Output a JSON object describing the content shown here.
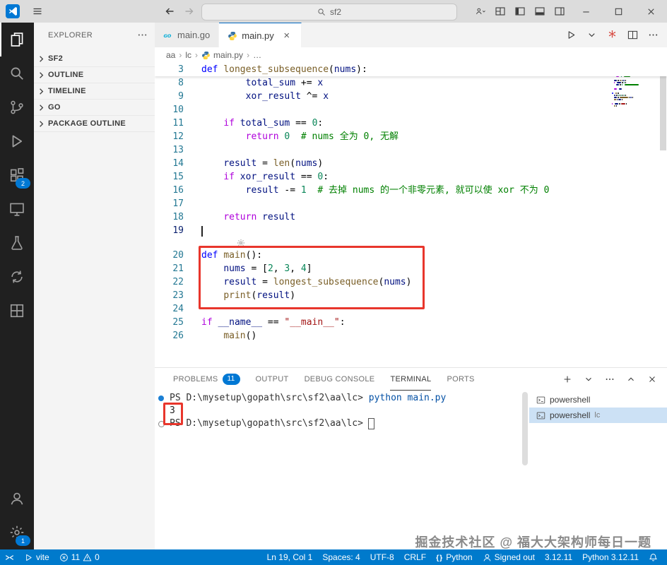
{
  "titlebar": {
    "search": "sf2",
    "right_icons": [
      "profile",
      "layout-grid",
      "sidebar-left",
      "panel-bottom",
      "sidebar-right"
    ],
    "window_controls": [
      "minimize",
      "maximize",
      "close"
    ]
  },
  "activity_bar": {
    "items": [
      {
        "name": "explorer",
        "active": true
      },
      {
        "name": "search"
      },
      {
        "name": "source-control"
      },
      {
        "name": "run-debug"
      },
      {
        "name": "extensions",
        "badge": "2"
      },
      {
        "name": "remote-explorer"
      },
      {
        "name": "testing"
      },
      {
        "name": "sync"
      },
      {
        "name": "grid"
      }
    ],
    "bottom": [
      {
        "name": "account"
      },
      {
        "name": "settings",
        "badge": "1"
      }
    ]
  },
  "sidebar": {
    "title": "EXPLORER",
    "sections": [
      {
        "label": "SF2"
      },
      {
        "label": "OUTLINE"
      },
      {
        "label": "TIMELINE"
      },
      {
        "label": "GO"
      },
      {
        "label": "PACKAGE OUTLINE"
      }
    ]
  },
  "editor_tabs": [
    {
      "label": "main.go",
      "icon": "go",
      "active": false
    },
    {
      "label": "main.py",
      "icon": "python",
      "active": true,
      "close": "×"
    }
  ],
  "editor_actions": [
    "run",
    "chevron-down",
    "extension",
    "split-editor",
    "more"
  ],
  "breadcrumb": [
    {
      "label": "aa"
    },
    {
      "label": "lc"
    },
    {
      "label": "main.py",
      "icon": "python"
    },
    {
      "label": "…"
    }
  ],
  "editor": {
    "cursor_line": "19",
    "lines": [
      {
        "num": "3",
        "sticky": true,
        "tokens": [
          {
            "t": "def",
            "c": "kw"
          },
          {
            "t": " "
          },
          {
            "t": "longest_subsequence",
            "c": "fn"
          },
          {
            "t": "("
          },
          {
            "t": "nums",
            "c": "var"
          },
          {
            "t": "):"
          }
        ]
      },
      {
        "num": "8",
        "tokens": [
          {
            "t": "        "
          },
          {
            "t": "total_sum",
            "c": "var"
          },
          {
            "t": " += "
          },
          {
            "t": "x",
            "c": "var"
          }
        ]
      },
      {
        "num": "9",
        "tokens": [
          {
            "t": "        "
          },
          {
            "t": "xor_result",
            "c": "var"
          },
          {
            "t": " ^= "
          },
          {
            "t": "x",
            "c": "var"
          }
        ]
      },
      {
        "num": "10",
        "tokens": []
      },
      {
        "num": "11",
        "tokens": [
          {
            "t": "    "
          },
          {
            "t": "if",
            "c": "ctrl"
          },
          {
            "t": " "
          },
          {
            "t": "total_sum",
            "c": "var"
          },
          {
            "t": " == "
          },
          {
            "t": "0",
            "c": "num"
          },
          {
            "t": ":"
          }
        ]
      },
      {
        "num": "12",
        "tokens": [
          {
            "t": "        "
          },
          {
            "t": "return",
            "c": "ctrl"
          },
          {
            "t": " "
          },
          {
            "t": "0",
            "c": "num"
          },
          {
            "t": "  "
          },
          {
            "t": "# nums 全为 0, 无解",
            "c": "com"
          }
        ]
      },
      {
        "num": "13",
        "tokens": []
      },
      {
        "num": "14",
        "tokens": [
          {
            "t": "    "
          },
          {
            "t": "result",
            "c": "var"
          },
          {
            "t": " = "
          },
          {
            "t": "len",
            "c": "fn"
          },
          {
            "t": "("
          },
          {
            "t": "nums",
            "c": "var"
          },
          {
            "t": ")"
          }
        ]
      },
      {
        "num": "15",
        "tokens": [
          {
            "t": "    "
          },
          {
            "t": "if",
            "c": "ctrl"
          },
          {
            "t": " "
          },
          {
            "t": "xor_result",
            "c": "var"
          },
          {
            "t": " == "
          },
          {
            "t": "0",
            "c": "num"
          },
          {
            "t": ":"
          }
        ]
      },
      {
        "num": "16",
        "tokens": [
          {
            "t": "        "
          },
          {
            "t": "result",
            "c": "var"
          },
          {
            "t": " -= "
          },
          {
            "t": "1",
            "c": "num"
          },
          {
            "t": "  "
          },
          {
            "t": "# 去掉 nums 的一个非零元素, 就可以使 xor 不为 0",
            "c": "com"
          }
        ]
      },
      {
        "num": "17",
        "tokens": []
      },
      {
        "num": "18",
        "tokens": [
          {
            "t": "    "
          },
          {
            "t": "return",
            "c": "ctrl"
          },
          {
            "t": " "
          },
          {
            "t": "result",
            "c": "var"
          }
        ]
      },
      {
        "num": "19",
        "active": true,
        "cursor": true,
        "tokens": []
      },
      {
        "num": "20",
        "gap": true,
        "tokens": [
          {
            "t": "def",
            "c": "kw"
          },
          {
            "t": " "
          },
          {
            "t": "main",
            "c": "fn"
          },
          {
            "t": "():"
          }
        ]
      },
      {
        "num": "21",
        "tokens": [
          {
            "t": "    "
          },
          {
            "t": "nums",
            "c": "var"
          },
          {
            "t": " = ["
          },
          {
            "t": "2",
            "c": "num"
          },
          {
            "t": ", "
          },
          {
            "t": "3",
            "c": "num"
          },
          {
            "t": ", "
          },
          {
            "t": "4",
            "c": "num"
          },
          {
            "t": "]"
          }
        ]
      },
      {
        "num": "22",
        "tokens": [
          {
            "t": "    "
          },
          {
            "t": "result",
            "c": "var"
          },
          {
            "t": " = "
          },
          {
            "t": "longest_subsequence",
            "c": "fn"
          },
          {
            "t": "("
          },
          {
            "t": "nums",
            "c": "var"
          },
          {
            "t": ")"
          }
        ]
      },
      {
        "num": "23",
        "tokens": [
          {
            "t": "    "
          },
          {
            "t": "print",
            "c": "fn"
          },
          {
            "t": "("
          },
          {
            "t": "result",
            "c": "var"
          },
          {
            "t": ")"
          }
        ]
      },
      {
        "num": "24",
        "tokens": []
      },
      {
        "num": "25",
        "tokens": [
          {
            "t": "if",
            "c": "ctrl"
          },
          {
            "t": " "
          },
          {
            "t": "__name__",
            "c": "var"
          },
          {
            "t": " == "
          },
          {
            "t": "\"__main__\"",
            "c": "str"
          },
          {
            "t": ":"
          }
        ]
      },
      {
        "num": "26",
        "tokens": [
          {
            "t": "    "
          },
          {
            "t": "main",
            "c": "fn"
          },
          {
            "t": "()"
          }
        ]
      }
    ]
  },
  "panel": {
    "tabs": [
      {
        "label": "PROBLEMS",
        "badge": "11"
      },
      {
        "label": "OUTPUT"
      },
      {
        "label": "DEBUG CONSOLE"
      },
      {
        "label": "TERMINAL",
        "active": true
      },
      {
        "label": "PORTS"
      }
    ],
    "actions": [
      "plus",
      "chevron-down",
      "more",
      "chevron-up",
      "close"
    ],
    "terminal": {
      "rows": [
        {
          "marker": "filled",
          "prompt": "PS D:\\mysetup\\gopath\\src\\sf2\\aa\\lc>",
          "command": " python main.py"
        },
        {
          "text": "3"
        },
        {
          "marker": "outline",
          "prompt": "PS D:\\mysetup\\gopath\\src\\sf2\\aa\\lc>",
          "cursor": true
        }
      ],
      "tabs_list": [
        {
          "icon": "terminal",
          "label": "powershell",
          "selected": false
        },
        {
          "icon": "terminal",
          "label": "powershell",
          "desc": "lc",
          "selected": true
        }
      ]
    }
  },
  "watermark": "掘金技术社区 @ 福大大架构师每日一题",
  "status_bar": {
    "left": [
      {
        "name": "remote",
        "icon": "remote"
      },
      {
        "name": "task-vite",
        "icon": "play",
        "label": "vite"
      },
      {
        "name": "problems",
        "icon": "error",
        "label": "11",
        "icon2": "warning",
        "label2": "0"
      }
    ],
    "right": [
      {
        "name": "cursor-position",
        "label": "Ln 19, Col 1"
      },
      {
        "name": "indentation",
        "label": "Spaces: 4"
      },
      {
        "name": "encoding",
        "label": "UTF-8"
      },
      {
        "name": "eol",
        "label": "CRLF"
      },
      {
        "name": "language-mode",
        "icon": "braces",
        "label": "Python"
      },
      {
        "name": "signed-out",
        "icon": "account",
        "label": "Signed out"
      },
      {
        "name": "version",
        "label": "3.12.11"
      },
      {
        "name": "python-interpreter",
        "label": "Python 3.12.11"
      },
      {
        "name": "notifications",
        "icon": "bell"
      }
    ]
  }
}
